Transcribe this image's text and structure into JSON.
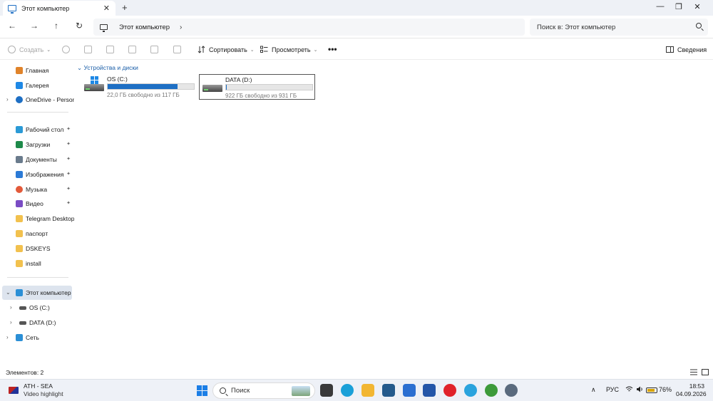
{
  "window": {
    "tab_title": "Этот компьютер",
    "new_tab_symbol": "+",
    "close_tab_symbol": "✕",
    "controls": {
      "minimize": "—",
      "maximize": "❐",
      "close": "✕"
    }
  },
  "address_bar": {
    "path": "Этот компьютер",
    "search_placeholder": "Поиск в: Этот компьютер"
  },
  "command_bar": {
    "create_label": "Создать",
    "sort_label": "Сортировать",
    "view_label": "Просмотреть",
    "more_label": "•••",
    "details_label": "Сведения"
  },
  "sidebar": {
    "top_items": [
      {
        "label": "Главная",
        "icon": "home-icon",
        "color": "#e0832a"
      },
      {
        "label": "Галерея",
        "icon": "gallery-icon",
        "color": "#1e88e5"
      },
      {
        "label": "OneDrive - Persona",
        "icon": "cloud-icon",
        "color": "#1e6fc4"
      }
    ],
    "quick_access": [
      {
        "label": "Рабочий стол",
        "icon": "desktop-icon",
        "color": "#2b9ad6",
        "pinned": true
      },
      {
        "label": "Загрузки",
        "icon": "download-icon",
        "color": "#1e8a4a",
        "pinned": true
      },
      {
        "label": "Документы",
        "icon": "documents-icon",
        "color": "#6a7b8c",
        "pinned": true
      },
      {
        "label": "Изображения",
        "icon": "pictures-icon",
        "color": "#2b7ad6",
        "pinned": true
      },
      {
        "label": "Музыка",
        "icon": "music-icon",
        "color": "#e35a3a",
        "pinned": true
      },
      {
        "label": "Видео",
        "icon": "videos-icon",
        "color": "#7a4cc4",
        "pinned": true
      },
      {
        "label": "Telegram Desktop",
        "icon": "folder-icon",
        "color": "#f2c14e",
        "pinned": false
      },
      {
        "label": "паспорт",
        "icon": "folder-icon",
        "color": "#f2c14e",
        "pinned": false
      },
      {
        "label": "DSKEYS",
        "icon": "folder-icon",
        "color": "#f2c14e",
        "pinned": false
      },
      {
        "label": "install",
        "icon": "folder-icon",
        "color": "#f2c14e",
        "pinned": false
      }
    ],
    "tree": [
      {
        "label": "Этот компьютер",
        "icon": "computer-icon",
        "selected": true
      },
      {
        "label": "OS (C:)",
        "icon": "drive-icon"
      },
      {
        "label": "DATA (D:)",
        "icon": "drive-icon"
      },
      {
        "label": "Сеть",
        "icon": "network-icon"
      }
    ],
    "pin_symbol": "📌"
  },
  "content": {
    "group_header": "Устройства и диски",
    "drives": [
      {
        "name": "OS (C:)",
        "free_text": "22,0 ГБ свободно из 117 ГБ",
        "used_fraction": 0.81,
        "selected": false
      },
      {
        "name": "DATA (D:)",
        "free_text": "922 ГБ свободно из 931 ГБ",
        "used_fraction": 0.01,
        "selected": true
      }
    ]
  },
  "status_bar": {
    "items_count": "Элементов: 2"
  },
  "taskbar": {
    "news_title": "ATH - SEA",
    "news_subtitle": "Video highlight",
    "search_label": "Поиск",
    "apps": [
      {
        "name": "terminal-app-icon",
        "color": "#3a3a3a"
      },
      {
        "name": "edge-app-icon",
        "color": "#1aa0d8"
      },
      {
        "name": "file-explorer-app-icon",
        "color": "#f2b632"
      },
      {
        "name": "store-app-icon",
        "color": "#245a8c"
      },
      {
        "name": "vscode-app-icon",
        "color": "#2b6fd1"
      },
      {
        "name": "word-app-icon",
        "color": "#2456a8"
      },
      {
        "name": "opera-app-icon",
        "color": "#e0222a"
      },
      {
        "name": "telegram-app-icon",
        "color": "#2aa3dd"
      },
      {
        "name": "utorrent-app-icon",
        "color": "#3d9a3a"
      },
      {
        "name": "settings-app-icon",
        "color": "#5a6a7d"
      }
    ],
    "language": "РУС",
    "battery": "76%",
    "time": "18:53",
    "date": "04.09.2026",
    "tray_chevron": "∧"
  }
}
